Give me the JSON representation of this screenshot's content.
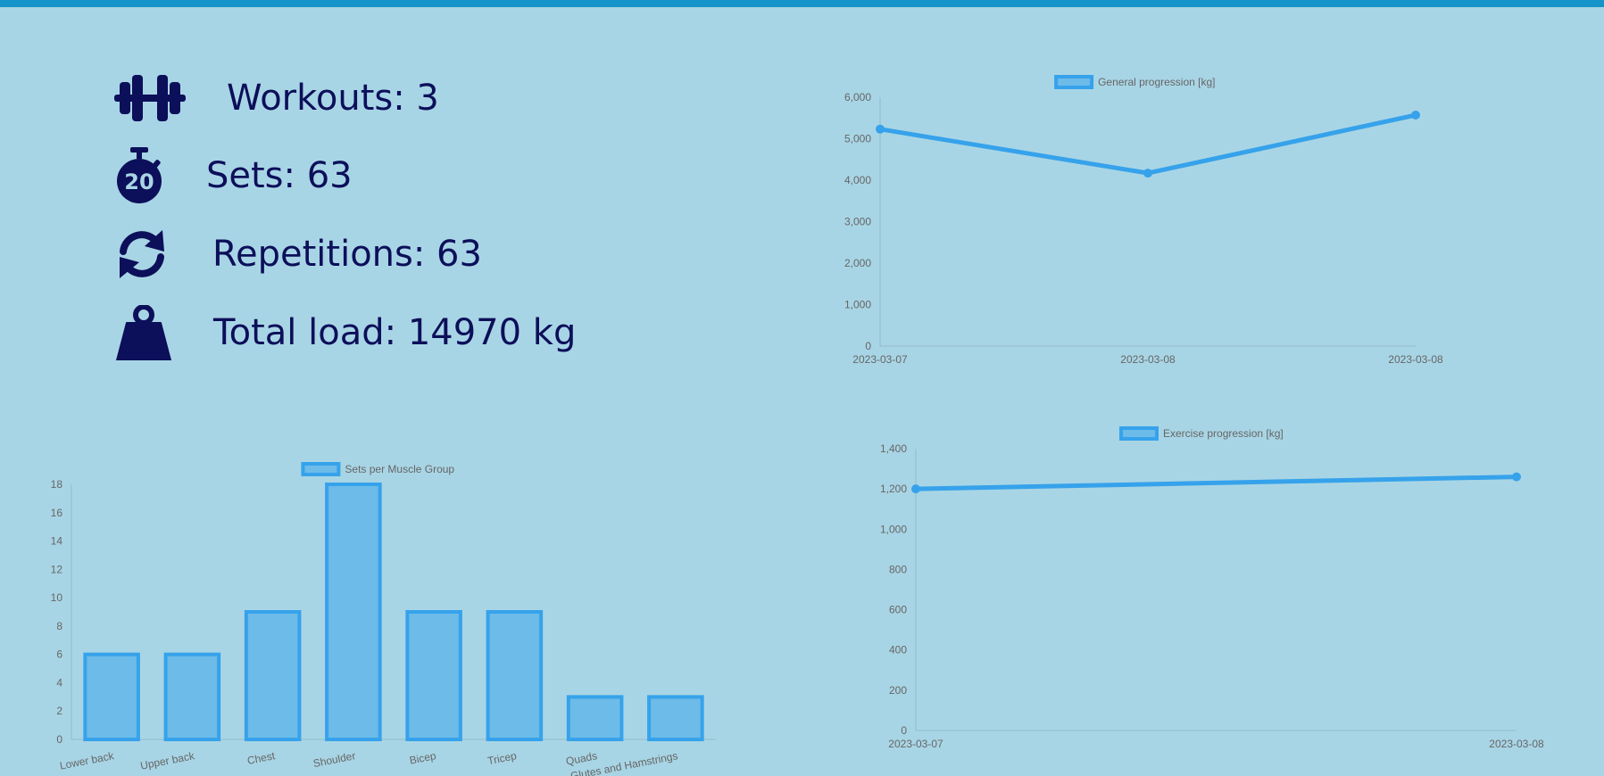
{
  "stats": {
    "workouts": "Workouts: 3",
    "sets": "Sets: 63",
    "repetitions": "Repetitions: 63",
    "total_load": "Total load: 14970 kg",
    "icons": [
      "dumbbell-icon",
      "stopwatch-icon",
      "refresh-icon",
      "weight-icon"
    ]
  },
  "colors": {
    "background": "#a8d5e5",
    "accent": "#36a2eb",
    "bar_fill": "#6cbbe8",
    "icon": "#0c0f5a",
    "topbar": "#1594c9"
  },
  "chart_data": [
    {
      "id": "general",
      "type": "line",
      "title": "",
      "legend": "General progression [kg]",
      "x": [
        "2023-03-07",
        "2023-03-08",
        "2023-03-08"
      ],
      "series": [
        {
          "name": "General progression [kg]",
          "values": [
            5230,
            4170,
            5570
          ]
        }
      ],
      "ylim": [
        0,
        6000
      ],
      "yticks": [
        "0",
        "1,000",
        "2,000",
        "3,000",
        "4,000",
        "5,000",
        "6,000"
      ],
      "ytick_values": [
        0,
        1000,
        2000,
        3000,
        4000,
        5000,
        6000
      ],
      "legend_position": "top-center",
      "grid": false
    },
    {
      "id": "exercise",
      "type": "line",
      "title": "",
      "legend": "Exercise progression [kg]",
      "x": [
        "2023-03-07",
        "2023-03-08"
      ],
      "series": [
        {
          "name": "Exercise progression [kg]",
          "values": [
            1200,
            1260
          ]
        }
      ],
      "ylim": [
        0,
        1400
      ],
      "yticks": [
        "0",
        "200",
        "400",
        "600",
        "800",
        "1,000",
        "1,200",
        "1,400"
      ],
      "ytick_values": [
        0,
        200,
        400,
        600,
        800,
        1000,
        1200,
        1400
      ],
      "legend_position": "top-center",
      "grid": false
    },
    {
      "id": "muscle",
      "type": "bar",
      "title": "",
      "legend": "Sets per Muscle Group",
      "categories": [
        "Lower back",
        "Upper back",
        "Chest",
        "Shoulder",
        "Bicep",
        "Tricep",
        "Quads",
        "Glutes and Hamstrings"
      ],
      "values": [
        6,
        6,
        9,
        18,
        9,
        9,
        3,
        3
      ],
      "ylim": [
        0,
        18
      ],
      "yticks": [
        "0",
        "2",
        "4",
        "6",
        "8",
        "10",
        "12",
        "14",
        "16",
        "18"
      ],
      "ytick_values": [
        0,
        2,
        4,
        6,
        8,
        10,
        12,
        14,
        16,
        18
      ],
      "legend_position": "top-center",
      "grid": false
    }
  ]
}
